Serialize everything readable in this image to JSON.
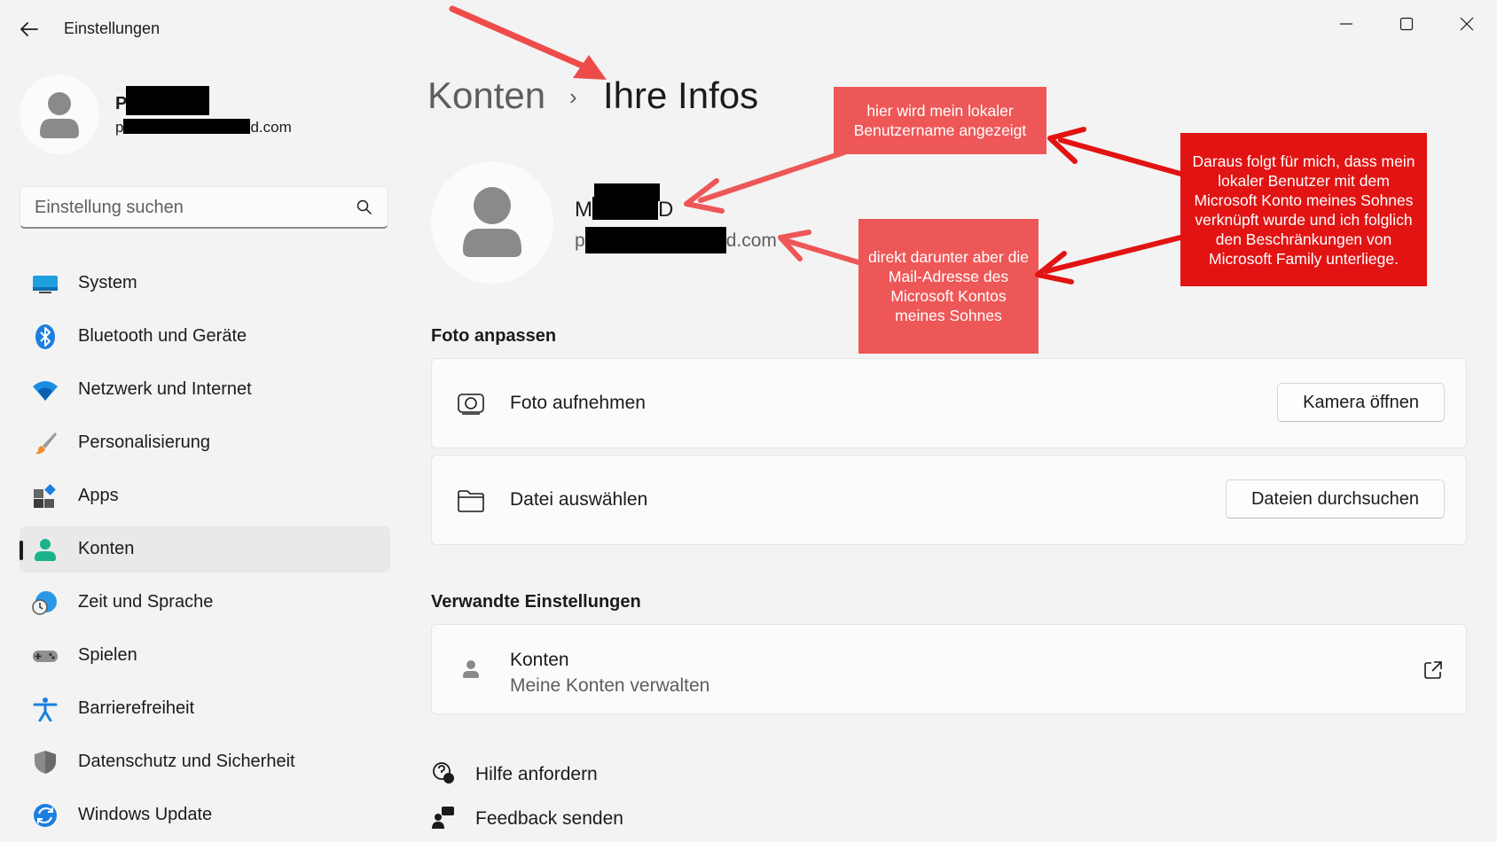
{
  "window": {
    "title": "Einstellungen",
    "controls": [
      "minimize-icon",
      "maximize-icon",
      "close-icon"
    ]
  },
  "profile": {
    "name_visible": "P",
    "mail_prefix": "p",
    "mail_suffix": "d.com"
  },
  "search": {
    "placeholder": "Einstellung suchen"
  },
  "sidebar": {
    "items": [
      {
        "label": "System",
        "icon": "monitor-icon"
      },
      {
        "label": "Bluetooth und Geräte",
        "icon": "bluetooth-icon"
      },
      {
        "label": "Netzwerk und Internet",
        "icon": "wifi-icon"
      },
      {
        "label": "Personalisierung",
        "icon": "paintbrush-icon"
      },
      {
        "label": "Apps",
        "icon": "apps-icon"
      },
      {
        "label": "Konten",
        "icon": "person-icon",
        "active": true
      },
      {
        "label": "Zeit und Sprache",
        "icon": "globe-clock-icon"
      },
      {
        "label": "Spielen",
        "icon": "gamepad-icon"
      },
      {
        "label": "Barrierefreiheit",
        "icon": "accessibility-icon"
      },
      {
        "label": "Datenschutz und Sicherheit",
        "icon": "shield-icon"
      },
      {
        "label": "Windows Update",
        "icon": "update-icon"
      }
    ]
  },
  "main": {
    "breadcrumb": {
      "parent": "Konten",
      "separator": "›",
      "current": "Ihre Infos"
    },
    "account": {
      "name_start": "M",
      "name_end": "D",
      "mail_prefix": "p",
      "mail_suffix": "d.com"
    },
    "photo_section": {
      "title": "Foto anpassen",
      "rows": [
        {
          "label": "Foto aufnehmen",
          "button": "Kamera öffnen",
          "icon": "camera-icon"
        },
        {
          "label": "Datei auswählen",
          "button": "Dateien durchsuchen",
          "icon": "folder-icon"
        }
      ]
    },
    "related": {
      "title": "Verwandte Einstellungen",
      "row": {
        "label": "Konten",
        "sublabel": "Meine Konten verwalten",
        "icon": "person-icon",
        "action_icon": "open-external-icon"
      }
    },
    "links": [
      {
        "label": "Hilfe anfordern",
        "icon": "help-icon"
      },
      {
        "label": "Feedback senden",
        "icon": "feedback-icon"
      }
    ]
  },
  "annotations": {
    "note1": "hier wird mein lokaler Benutzername angezeigt",
    "note2": "direkt darunter aber die Mail-Adresse des Microsoft Kontos meines Sohnes",
    "note3": "Daraus folgt für mich, dass mein lokaler Benutzer mit dem Microsoft Konto meines Sohnes verknüpft wurde und ich folglich den Beschränkungen von Microsoft Family unterliege."
  },
  "colors": {
    "window_bg": "#f3f3f3",
    "card_bg": "#fbfbfb",
    "annotation_pale": "#ee5757",
    "annotation_red": "#e21313",
    "arrow_red": "#e21313"
  }
}
